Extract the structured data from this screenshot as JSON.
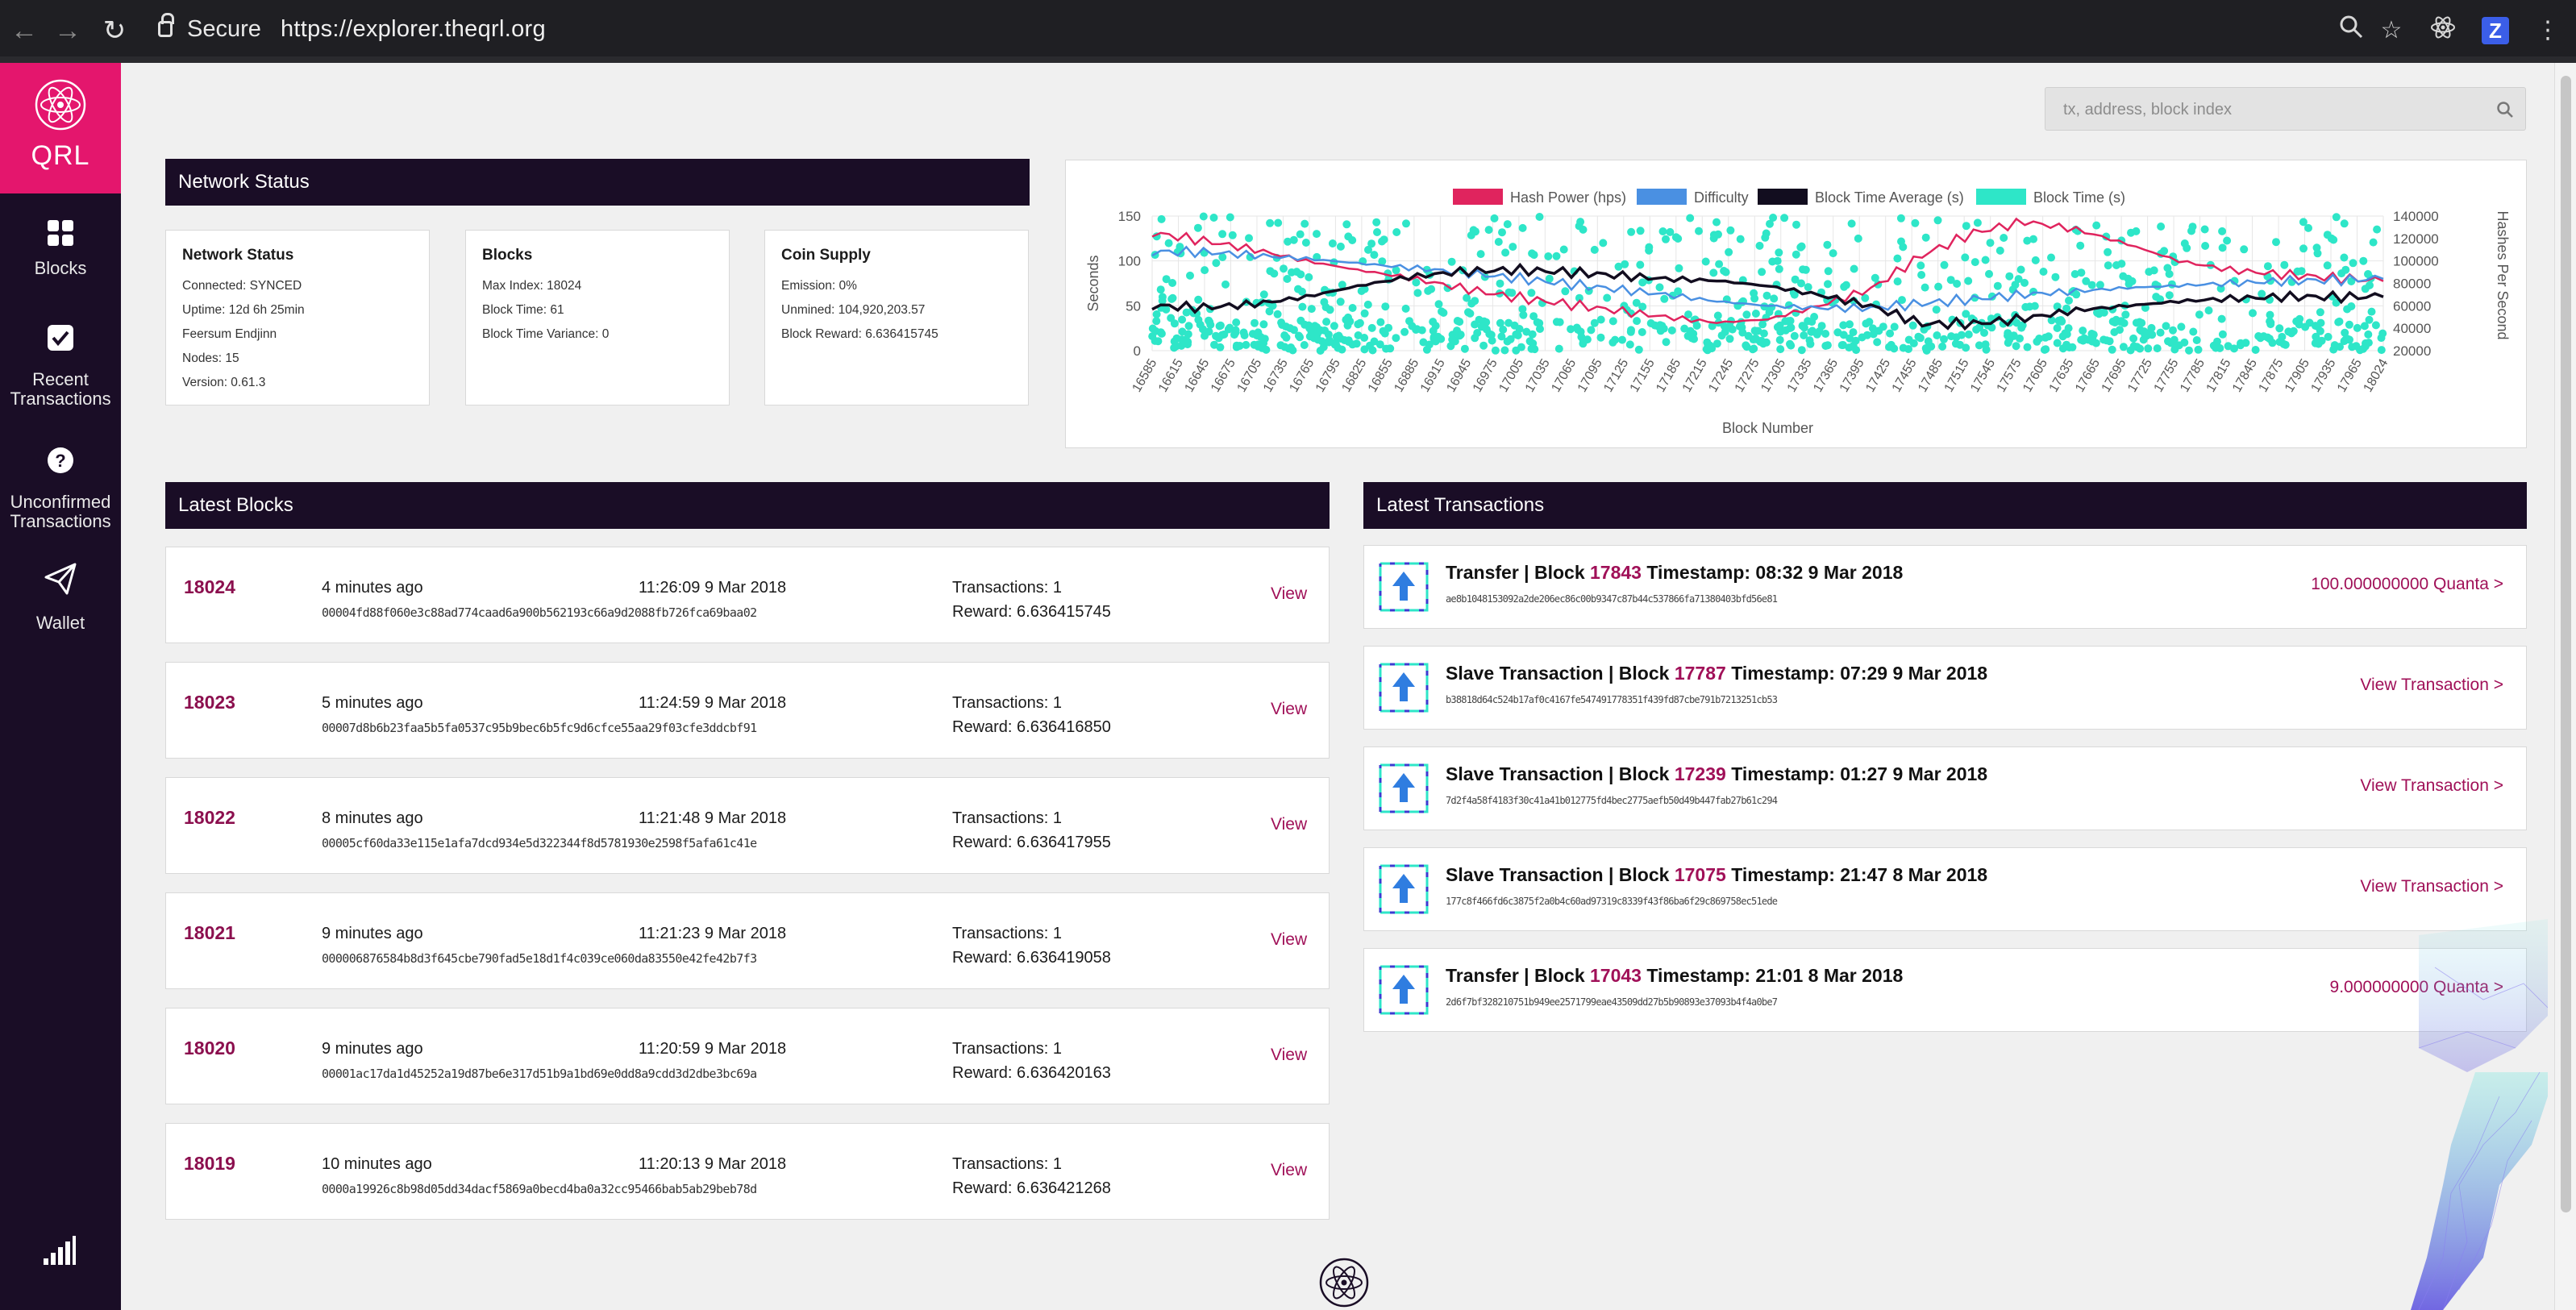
{
  "browser": {
    "secure_label": "Secure",
    "url": "https://explorer.theqrl.org",
    "icons": [
      "back-arrow-icon",
      "forward-arrow-icon",
      "reload-icon",
      "lock-icon",
      "zoom-icon",
      "star-icon",
      "react-extension-icon",
      "z-extension-icon",
      "kebab-menu-icon"
    ],
    "ext_z": "Z"
  },
  "sidebar": {
    "logo_text": "QRL",
    "items": [
      {
        "label_line1": "Blocks",
        "label_line2": "",
        "icon": "blocks-grid-icon"
      },
      {
        "label_line1": "Recent",
        "label_line2": "Transactions",
        "icon": "check-square-icon"
      },
      {
        "label_line1": "Unconfirmed",
        "label_line2": "Transactions",
        "icon": "question-circle-icon"
      },
      {
        "label_line1": "Wallet",
        "label_line2": "",
        "icon": "paper-plane-icon"
      }
    ],
    "accent": "#e4166d",
    "bg": "#1a0d26"
  },
  "search": {
    "placeholder": "tx, address, block index"
  },
  "network_status": {
    "header": "Network Status",
    "cards": [
      {
        "title": "Network Status",
        "lines": [
          "Connected: SYNCED",
          "Uptime: 12d 6h 25min",
          "Feersum Endjinn",
          "Nodes: 15",
          "Version: 0.61.3"
        ]
      },
      {
        "title": "Blocks",
        "lines": [
          "Max Index: 18024",
          "Block Time: 61",
          "Block Time Variance: 0"
        ]
      },
      {
        "title": "Coin Supply",
        "lines": [
          "Emission: 0%",
          "Unmined: 104,920,203.57",
          "Block Reward: 6.636415745"
        ]
      }
    ]
  },
  "chart_data": {
    "type": "line",
    "legend": [
      {
        "name": "Hash Power (hps)",
        "color": "#e0245e"
      },
      {
        "name": "Difficulty",
        "color": "#4a90e2"
      },
      {
        "name": "Block Time Average (s)",
        "color": "#120d1f"
      },
      {
        "name": "Block Time (s)",
        "color": "#2ee6c8"
      }
    ],
    "legend_position": "top",
    "xlabel": "Block Number",
    "ylabel_left": "Seconds",
    "ylabel_right": "Hashes Per Second",
    "ylim_left": [
      0,
      150
    ],
    "ylim_right": [
      20000,
      140000
    ],
    "y_ticks_left": [
      "150",
      "100",
      "50",
      "0"
    ],
    "y_ticks_right": [
      "140000",
      "120000",
      "100000",
      "80000",
      "60000",
      "40000",
      "20000"
    ],
    "x_ticks": [
      "16585",
      "16615",
      "16645",
      "16675",
      "16705",
      "16735",
      "16765",
      "16795",
      "16825",
      "16855",
      "16885",
      "16915",
      "16945",
      "16975",
      "17005",
      "17035",
      "17065",
      "17095",
      "17125",
      "17155",
      "17185",
      "17215",
      "17245",
      "17275",
      "17305",
      "17335",
      "17365",
      "17395",
      "17425",
      "17455",
      "17485",
      "17515",
      "17545",
      "17575",
      "17605",
      "17635",
      "17665",
      "17695",
      "17725",
      "17755",
      "17785",
      "17815",
      "17845",
      "17875",
      "17905",
      "17935",
      "17965",
      "18024"
    ],
    "x_range": [
      16585,
      18024
    ],
    "grid": true,
    "series": [
      {
        "name": "Hash Power (hps)",
        "axis": "right",
        "x": [
          16585,
          16645,
          16705,
          16765,
          16825,
          16885,
          16945,
          17005,
          17065,
          17125,
          17185,
          17245,
          17305,
          17365,
          17425,
          17485,
          17545,
          17605,
          17665,
          17725,
          17785,
          17845,
          17905,
          17965,
          18024
        ],
        "values": [
          125000,
          118000,
          110000,
          100000,
          92000,
          85000,
          76000,
          68000,
          62000,
          56000,
          50000,
          45000,
          48000,
          60000,
          75000,
          105000,
          125000,
          135000,
          128000,
          115000,
          100000,
          92000,
          88000,
          85000,
          82000
        ]
      },
      {
        "name": "Difficulty",
        "axis": "right",
        "x": [
          16585,
          16645,
          16705,
          16765,
          16825,
          16885,
          16945,
          17005,
          17065,
          17125,
          17185,
          17245,
          17305,
          17365,
          17425,
          17485,
          17545,
          17605,
          17665,
          17725,
          17785,
          17845,
          17905,
          17965,
          18024
        ],
        "values": [
          108000,
          108000,
          105000,
          102000,
          98000,
          94000,
          90000,
          85000,
          80000,
          75000,
          70000,
          64000,
          60000,
          58000,
          58000,
          62000,
          66000,
          70000,
          73000,
          76000,
          78000,
          80000,
          82000,
          83000,
          84000
        ]
      },
      {
        "name": "Block Time Average (s)",
        "axis": "left",
        "x": [
          16585,
          16645,
          16705,
          16765,
          16825,
          16885,
          16945,
          17005,
          17065,
          17125,
          17185,
          17245,
          17305,
          17365,
          17425,
          17485,
          17545,
          17605,
          17665,
          17725,
          17785,
          17845,
          17905,
          17965,
          18024
        ],
        "values": [
          50,
          48,
          52,
          60,
          72,
          82,
          88,
          90,
          88,
          84,
          80,
          78,
          72,
          62,
          50,
          30,
          30,
          36,
          45,
          50,
          55,
          58,
          60,
          60,
          60
        ]
      },
      {
        "name": "Block Time (s)",
        "type": "scatter",
        "axis": "left",
        "note": "dense scatter of individual block times between 0 and 150 s"
      }
    ]
  },
  "latest_blocks": {
    "header": "Latest Blocks",
    "view_label": "View",
    "rows": [
      {
        "number": "18024",
        "ago": "4 minutes ago",
        "timestamp": "11:26:09 9 Mar 2018",
        "hash": "00004fd88f060e3c88ad774caad6a900b562193c66a9d2088fb726fca69baa02",
        "transactions": "Transactions: 1",
        "reward": "Reward: 6.636415745"
      },
      {
        "number": "18023",
        "ago": "5 minutes ago",
        "timestamp": "11:24:59 9 Mar 2018",
        "hash": "00007d8b6b23faa5b5fa0537c95b9bec6b5fc9d6cfce55aa29f03cfe3ddcbf91",
        "transactions": "Transactions: 1",
        "reward": "Reward: 6.636416850"
      },
      {
        "number": "18022",
        "ago": "8 minutes ago",
        "timestamp": "11:21:48 9 Mar 2018",
        "hash": "00005cf60da33e115e1afa7dcd934e5d322344f8d5781930e2598f5afa61c41e",
        "transactions": "Transactions: 1",
        "reward": "Reward: 6.636417955"
      },
      {
        "number": "18021",
        "ago": "9 minutes ago",
        "timestamp": "11:21:23 9 Mar 2018",
        "hash": "000006876584b8d3f645cbe790fad5e18d1f4c039ce060da83550e42fe42b7f3",
        "transactions": "Transactions: 1",
        "reward": "Reward: 6.636419058"
      },
      {
        "number": "18020",
        "ago": "9 minutes ago",
        "timestamp": "11:20:59 9 Mar 2018",
        "hash": "00001ac17da1d45252a19d87be6e317d51b9a1bd69e0dd8a9cdd3d2dbe3bc69a",
        "transactions": "Transactions: 1",
        "reward": "Reward: 6.636420163"
      },
      {
        "number": "18019",
        "ago": "10 minutes ago",
        "timestamp": "11:20:13 9 Mar 2018",
        "hash": "0000a19926c8b98d05dd34dacf5869a0becd4ba0a32cc95466bab5ab29beb78d",
        "transactions": "Transactions: 1",
        "reward": "Reward: 6.636421268"
      }
    ]
  },
  "latest_transactions": {
    "header": "Latest Transactions",
    "rows": [
      {
        "type": "Transfer | Block",
        "block": "17843",
        "timestamp": "Timestamp: 08:32 9 Mar 2018",
        "hash": "ae8b1048153092a2de206ec86c00b9347c87b44c537866fa71380403bfd56e81",
        "link": "100.000000000 Quanta >"
      },
      {
        "type": "Slave Transaction | Block",
        "block": "17787",
        "timestamp": "Timestamp: 07:29 9 Mar 2018",
        "hash": "b38818d64c524b17af0c4167fe547491778351f439fd87cbe791b7213251cb53",
        "link": "View Transaction >"
      },
      {
        "type": "Slave Transaction | Block",
        "block": "17239",
        "timestamp": "Timestamp: 01:27 9 Mar 2018",
        "hash": "7d2f4a58f4183f30c41a41b012775fd4bec2775aefb50d49b447fab27b61c294",
        "link": "View Transaction >"
      },
      {
        "type": "Slave Transaction | Block",
        "block": "17075",
        "timestamp": "Timestamp: 21:47 8 Mar 2018",
        "hash": "177c8f466fd6c3875f2a0b4c60ad97319c8339f43f86ba6f29c869758ec51ede",
        "link": "View Transaction >"
      },
      {
        "type": "Transfer | Block",
        "block": "17043",
        "timestamp": "Timestamp: 21:01 8 Mar 2018",
        "hash": "2d6f7bf328210751b949ee2571799eae43509dd27b5b90893e37093b4f4a0be7",
        "link": "9.000000000 Quanta >"
      }
    ]
  }
}
